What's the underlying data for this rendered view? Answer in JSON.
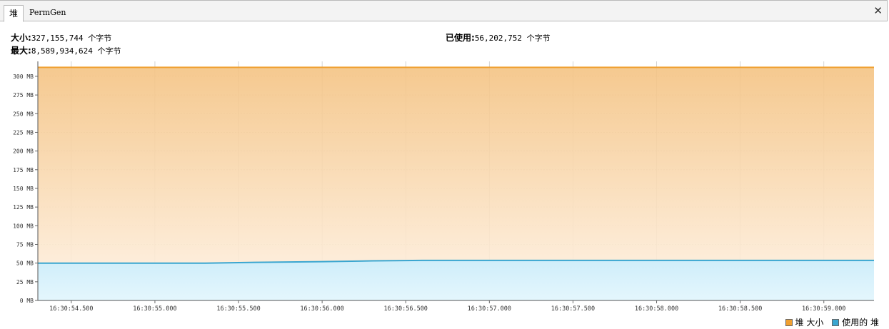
{
  "tabs": [
    {
      "label": "堆",
      "active": true
    },
    {
      "label": "PermGen",
      "active": false
    }
  ],
  "close_icon": "close-icon",
  "info": {
    "size_label": "大小:",
    "size_value": "327,155,744 个字节",
    "max_label": "最大:",
    "max_value": "8,589,934,624 个字节",
    "used_label": "已使用:",
    "used_value": "56,202,752 个字节"
  },
  "colors": {
    "heap_size": "#f0a030",
    "used_heap": "#3aa6d0"
  },
  "chart_data": {
    "type": "area",
    "title": "",
    "xlabel": "",
    "ylabel": "",
    "ylim": [
      0,
      320
    ],
    "xlim": [
      "16:30:54.300",
      "16:30:59.300"
    ],
    "y_ticks": [
      "0 MB",
      "25 MB",
      "50 MB",
      "75 MB",
      "100 MB",
      "125 MB",
      "150 MB",
      "175 MB",
      "200 MB",
      "225 MB",
      "250 MB",
      "275 MB",
      "300 MB"
    ],
    "x_ticks": [
      "16:30:54.500",
      "16:30:55.000",
      "16:30:55.500",
      "16:30:56.000",
      "16:30:56.500",
      "16:30:57.000",
      "16:30:57.500",
      "16:30:58.000",
      "16:30:58.500",
      "16:30:59.000"
    ],
    "x": [
      "16:30:54.300",
      "16:30:55.300",
      "16:30:55.600",
      "16:30:56.000",
      "16:30:56.300",
      "16:30:56.600",
      "16:30:57.000",
      "16:30:58.000",
      "16:30:59.000",
      "16:30:59.300"
    ],
    "series": [
      {
        "name": "堆 大小",
        "values": [
          312,
          312,
          312,
          312,
          312,
          312,
          312,
          312,
          312,
          312
        ]
      },
      {
        "name": "使用的 堆",
        "values": [
          50,
          50,
          51,
          52,
          53,
          53.6,
          53.6,
          53.6,
          53.6,
          53.6
        ]
      }
    ],
    "grid": true,
    "legend_position": "bottom-right"
  }
}
